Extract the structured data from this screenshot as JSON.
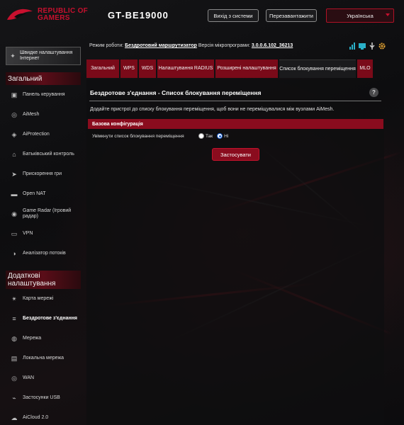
{
  "brand": {
    "line1": "REPUBLIC OF",
    "line2": "GAMERS",
    "model": "GT-BE19000"
  },
  "header": {
    "logout_label": "Вихід з системи",
    "reboot_label": "Перезавантажити",
    "language": "Українська"
  },
  "sidebar": {
    "quick_setup": "Швидке налаштування Інтернет",
    "general_title": "Загальний",
    "general_items": [
      {
        "label": "Панель керування",
        "icon": "dashboard-icon"
      },
      {
        "label": "AiMesh",
        "icon": "aimesh-icon"
      },
      {
        "label": "AiProtection",
        "icon": "shield-icon"
      },
      {
        "label": "Батьківський контроль",
        "icon": "parental-icon"
      },
      {
        "label": "Прискорення гри",
        "icon": "rocket-icon"
      },
      {
        "label": "Open NAT",
        "icon": "nat-icon"
      },
      {
        "label": "Game Radar (Ігровий радар)",
        "icon": "radar-icon"
      },
      {
        "label": "VPN",
        "icon": "vpn-icon"
      },
      {
        "label": "Аналізатор потоків",
        "icon": "analyzer-icon"
      }
    ],
    "advanced_title": "Додаткові налаштування",
    "advanced_items": [
      {
        "label": "Карта мережі",
        "icon": "network-map-icon"
      },
      {
        "label": "Бездротове з'єднання",
        "icon": "wireless-icon",
        "active": true
      },
      {
        "label": "Мережа",
        "icon": "network-icon"
      },
      {
        "label": "Локальна мережа",
        "icon": "lan-icon"
      },
      {
        "label": "WAN",
        "icon": "globe-icon"
      },
      {
        "label": "Застосунки USB",
        "icon": "usb-icon"
      },
      {
        "label": "AiCloud 2.0",
        "icon": "cloud-icon"
      }
    ]
  },
  "status": {
    "mode_label": "Режим роботи:",
    "mode_value": "Бездротовий маршрутизатор",
    "fw_label": "Версія мікропрограми:",
    "fw_value": "3.0.0.6.102_36213"
  },
  "tabs": [
    {
      "label": "Загальний"
    },
    {
      "label": "WPS"
    },
    {
      "label": "WDS"
    },
    {
      "label": "Налаштування RADIUS"
    },
    {
      "label": "Розширені налаштування"
    },
    {
      "label": "Список блокування переміщення",
      "active": true
    },
    {
      "label": "MLO"
    }
  ],
  "page": {
    "title": "Бездротове з'єднання - Список блокування переміщення",
    "description": "Додайте пристрої до списку блокування переміщення, щоб вони не переміщувалися між вузлами AiMesh.",
    "section_title": "Базова конфігурація",
    "field_label": "Увімкнути список блокування переміщення",
    "option_yes": "Так",
    "option_no": "Ні",
    "selected": "Ні",
    "apply_label": "Застосувати"
  },
  "colors": {
    "accent": "#8a0c1e",
    "brand_red": "#c8102e"
  }
}
